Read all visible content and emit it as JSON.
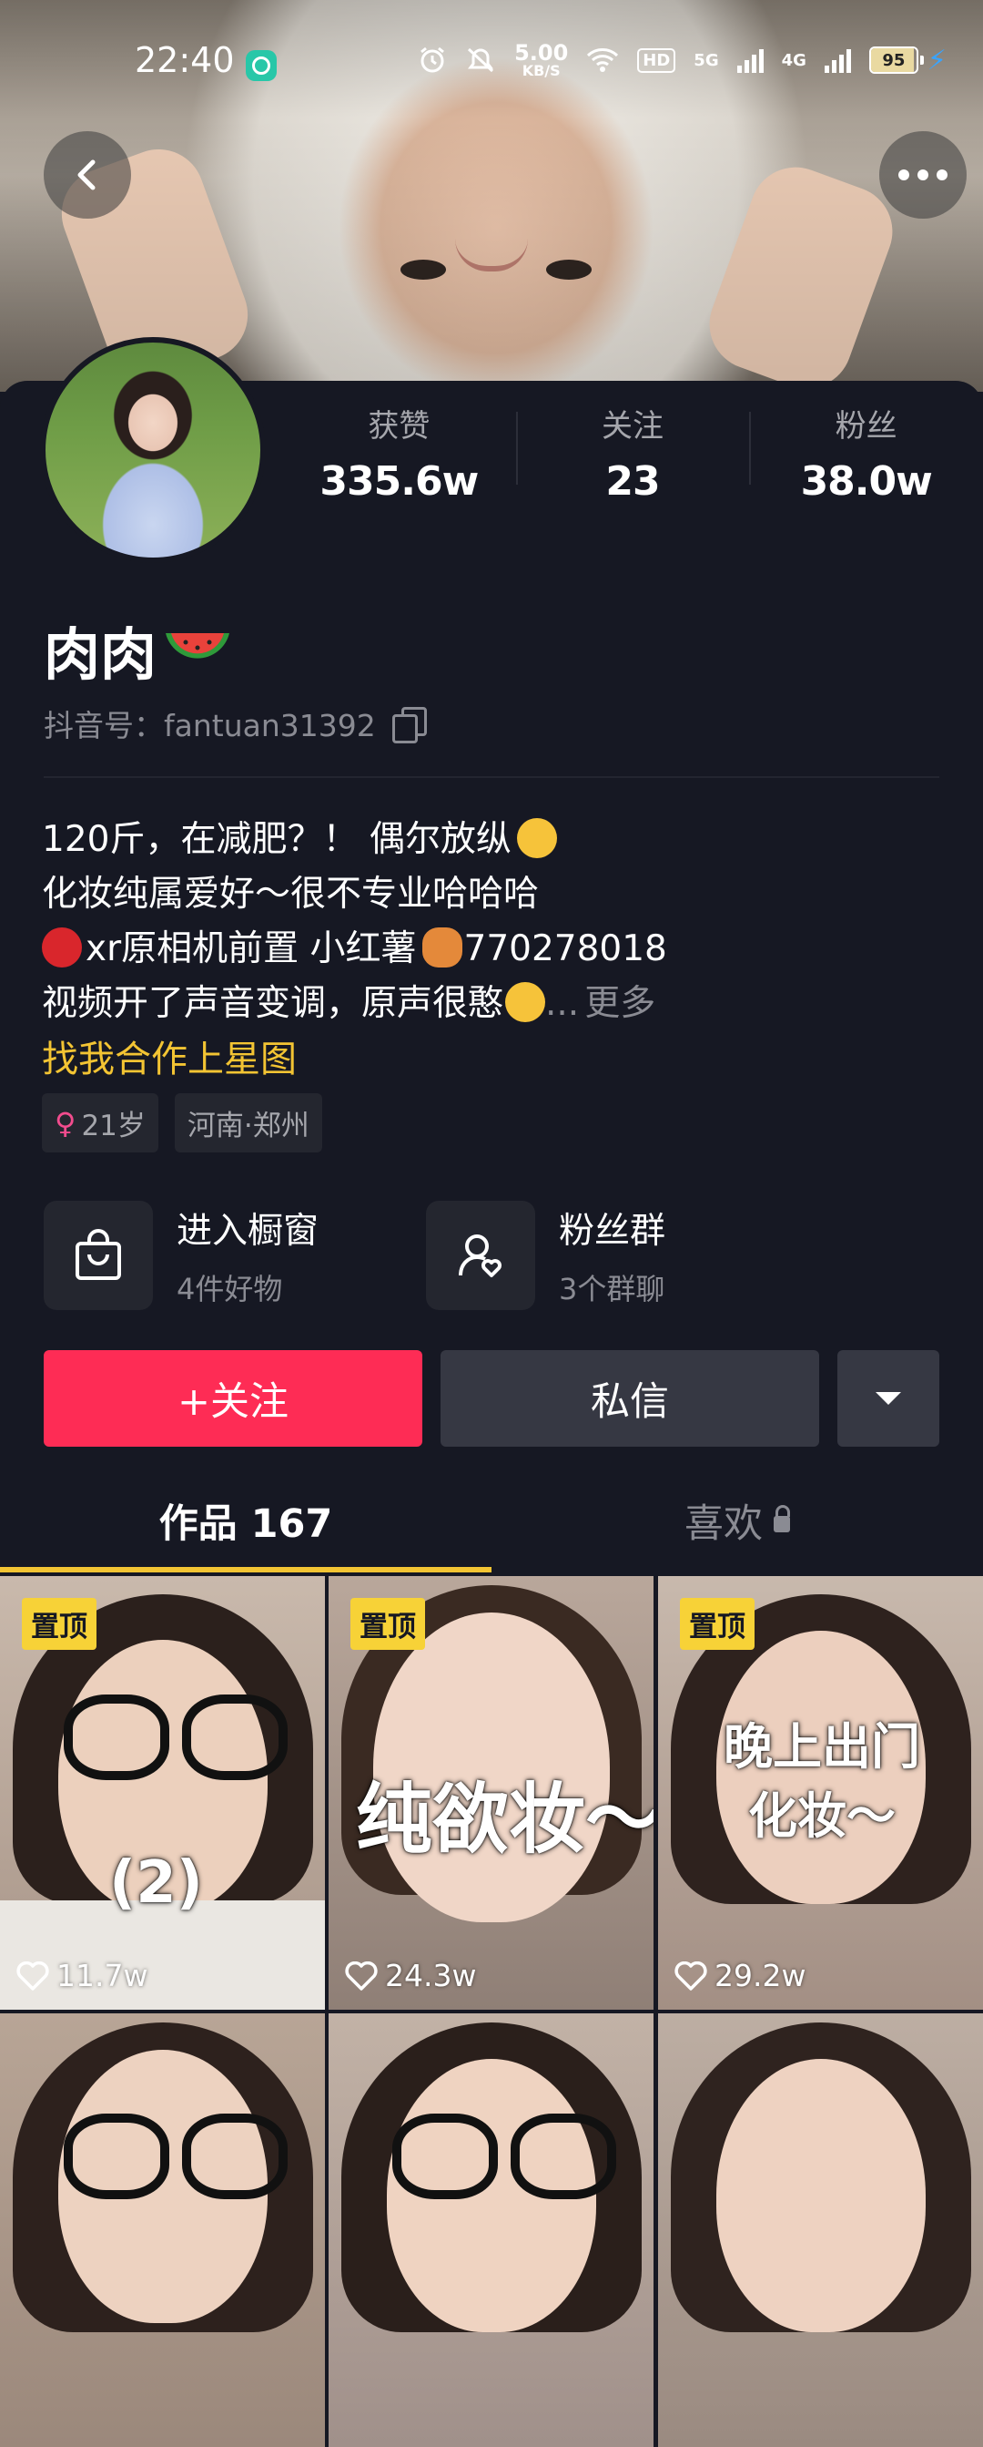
{
  "status_bar": {
    "time": "22:40",
    "speed_value": "5.00",
    "speed_unit": "KB/S",
    "hd_label": "HD",
    "net_5g": "5G",
    "net_4g": "4G",
    "battery": "95"
  },
  "profile": {
    "stats": [
      {
        "label": "获赞",
        "value": "335.6w"
      },
      {
        "label": "关注",
        "value": "23"
      },
      {
        "label": "粉丝",
        "value": "38.0w"
      }
    ],
    "name": "肉肉",
    "id_line": "抖音号：fantuan31392",
    "bio": {
      "line1": "120斤，在减肥？！ 偶尔放纵",
      "line2": "化妆纯属爱好～很不专业哈哈哈",
      "line3_a": "xr原相机前置   小红薯",
      "line3_b": "770278018",
      "line4": "视频开了声音变调，原声很憨",
      "ellipsis": "...",
      "more": "更多"
    },
    "star_link": "找我合作上星图",
    "tags": {
      "age": "21岁",
      "location": "河南·郑州"
    }
  },
  "quick_links": {
    "shop": {
      "title": "进入橱窗",
      "sub": "4件好物"
    },
    "fans": {
      "title": "粉丝群",
      "sub": "3个群聊"
    }
  },
  "actions": {
    "follow": "+关注",
    "message": "私信"
  },
  "tabs": {
    "works": "作品 167",
    "likes": "喜欢"
  },
  "videos": [
    {
      "pinned": "置顶",
      "overlay": "(2)",
      "likes": "11.7w"
    },
    {
      "pinned": "置顶",
      "overlay": "纯欲妆～",
      "likes": "24.3w"
    },
    {
      "pinned": "置顶",
      "overlay_line1": "晚上出门",
      "overlay_line2": "化妆～",
      "likes": "29.2w"
    }
  ],
  "colors": {
    "background": "#161823",
    "follow_button": "#fe2c55",
    "link_yellow": "#f3c433",
    "pin_badge": "#f7d237"
  },
  "icons": [
    "back-arrow-icon",
    "more-dots-icon",
    "copy-icon",
    "female-icon",
    "bag-icon",
    "fan-group-icon",
    "dropdown-triangle-icon",
    "lock-icon",
    "heart-icon"
  ]
}
